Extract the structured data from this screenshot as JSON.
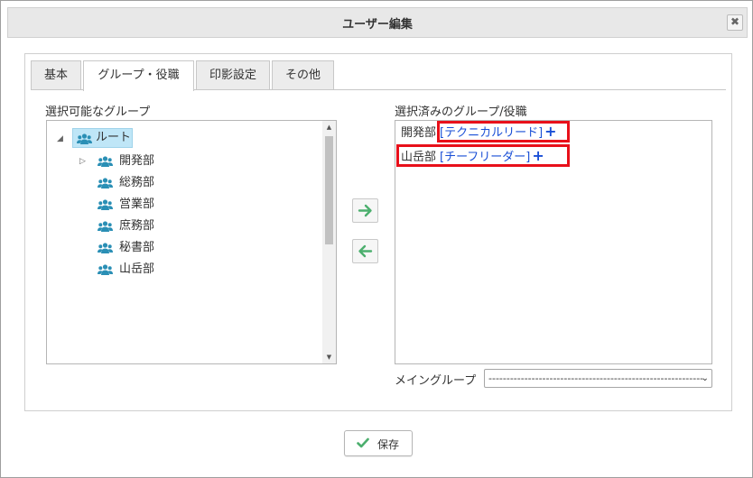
{
  "dialog": {
    "title": "ユーザー編集",
    "close_glyph": "✖"
  },
  "tabs": [
    {
      "label": "基本",
      "active": false
    },
    {
      "label": "グループ・役職",
      "active": true
    },
    {
      "label": "印影設定",
      "active": false
    },
    {
      "label": "その他",
      "active": false
    }
  ],
  "available": {
    "label": "選択可能なグループ",
    "root": {
      "label": "ルート",
      "toggle": "◢"
    },
    "children": [
      {
        "label": "開発部",
        "toggle": "▷"
      },
      {
        "label": "総務部"
      },
      {
        "label": "営業部"
      },
      {
        "label": "庶務部"
      },
      {
        "label": "秘書部"
      },
      {
        "label": "山岳部"
      }
    ]
  },
  "selected": {
    "label": "選択済みのグループ/役職",
    "items": [
      {
        "group": "開発部",
        "role": "[テクニカルリード]",
        "plus": "+"
      },
      {
        "group": "山岳部",
        "role": "[チーフリーダー]",
        "plus": "+"
      }
    ]
  },
  "main_group": {
    "label": "メイングループ",
    "value": "------------------------------------------------------------"
  },
  "buttons": {
    "save": "保存"
  },
  "colors": {
    "accent_green": "#4caf6e",
    "link_blue": "#1a4fd6",
    "highlight_red": "#e8101a",
    "icon_teal": "#2a8fb5"
  }
}
